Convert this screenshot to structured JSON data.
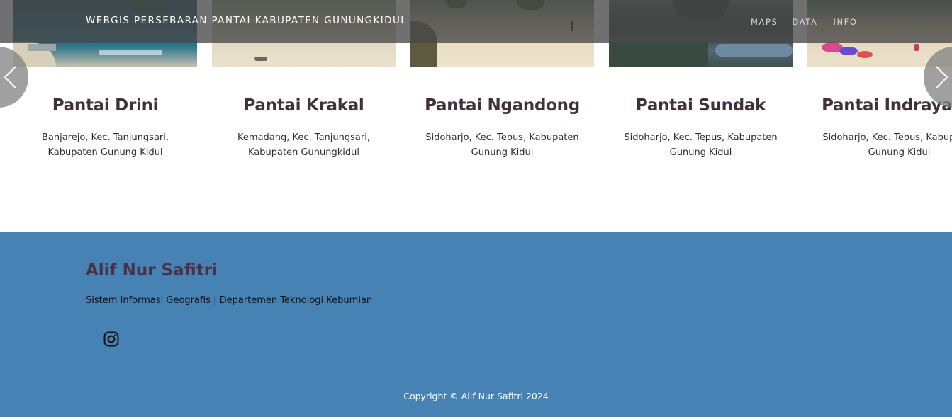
{
  "navbar": {
    "brand": "WEBGIS PERSEBARAN PANTAI KABUPATEN GUNUNGKIDUL",
    "links": [
      "MAPS",
      "DATA",
      "INFO"
    ]
  },
  "carousel": {
    "cards": [
      {
        "title": "Pantai Drini",
        "address": "Banjarejo, Kec. Tanjungsari, Kabupaten Gunung Kidul"
      },
      {
        "title": "Pantai Krakal",
        "address": "Kemadang, Kec. Tanjungsari, Kabupaten Gunungkidul"
      },
      {
        "title": "Pantai Ngandong",
        "address": "Sidoharjo, Kec. Tepus, Kabupaten Gunung Kidul"
      },
      {
        "title": "Pantai Sundak",
        "address": "Sidoharjo, Kec. Tepus, Kabupaten Gunung Kidul"
      },
      {
        "title": "Pantai Indrayanti",
        "address": "Sidoharjo, Kec. Tepus, Kabupaten Gunung Kidul"
      }
    ]
  },
  "footer": {
    "name": "Alif Nur Safitri",
    "description": "Sistem Informasi Geografis | Departemen Teknologi Kebumian",
    "copyright": "Copyright © Alif Nur Safitri 2024"
  },
  "icons": {
    "prev": "chevron-left-icon",
    "next": "chevron-right-icon",
    "social": "instagram-icon"
  },
  "colors": {
    "footer_bg": "#4682b4",
    "title_text": "#40303c",
    "navbar_bg": "#484848"
  }
}
